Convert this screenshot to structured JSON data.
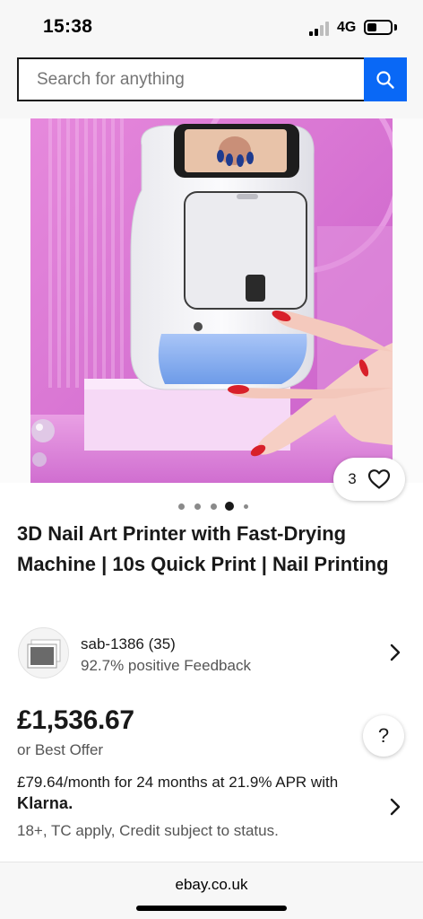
{
  "status_bar": {
    "time": "15:38",
    "network": "4G"
  },
  "search": {
    "placeholder": "Search for anything"
  },
  "gallery": {
    "like_count": "3",
    "dot_count": 5,
    "active_dot": 3
  },
  "product": {
    "title": "3D Nail Art Printer with Fast-Drying Machine | 10s Quick Print | Nail Printing"
  },
  "seller": {
    "name": "sab-1386 (35)",
    "feedback": "92.7% positive Feedback"
  },
  "pricing": {
    "price": "£1,536.67",
    "offer": "or Best Offer",
    "help_label": "?"
  },
  "financing": {
    "line": "£79.64/month for 24 months at 21.9% APR with",
    "provider": "Klarna.",
    "terms": "18+, TC apply, Credit subject to status."
  },
  "footer": {
    "domain": "ebay.co.uk"
  },
  "colors": {
    "accent": "#0968f6",
    "product_bg": "#d86fd8",
    "nail": "#d8202a"
  }
}
